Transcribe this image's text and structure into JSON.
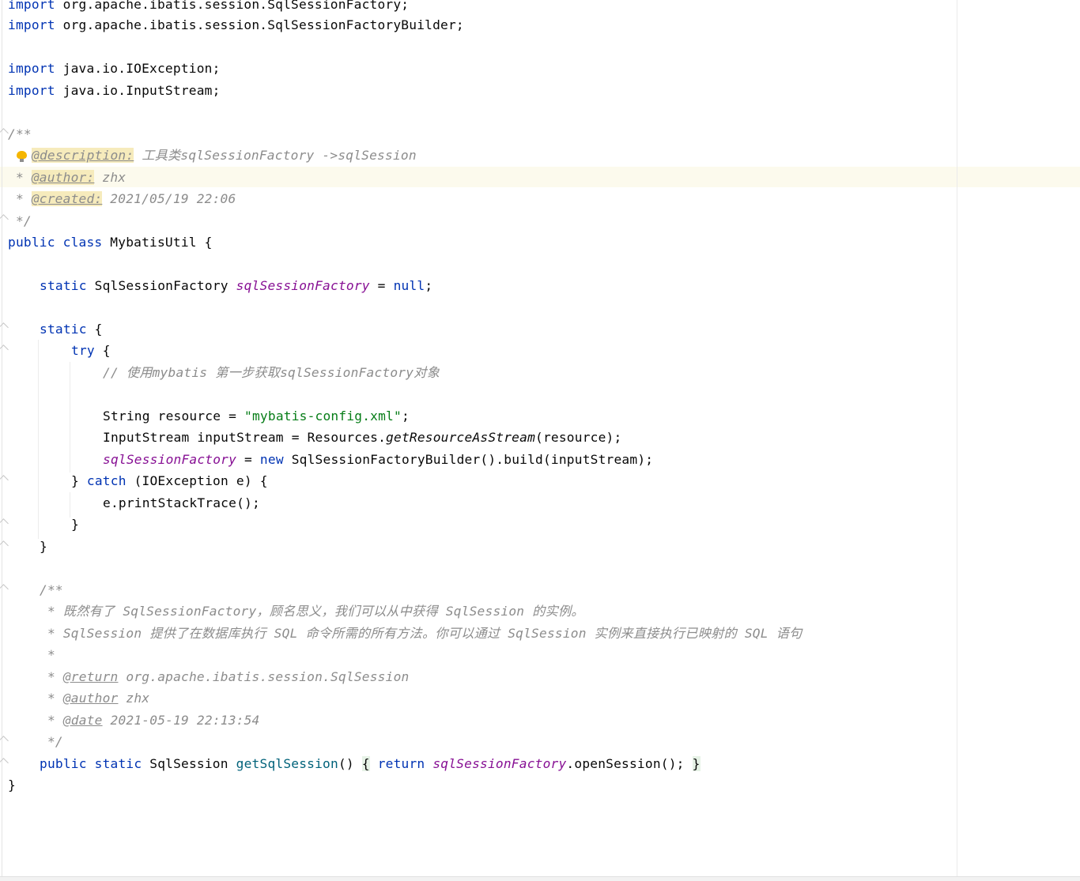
{
  "editor": {
    "language": "java",
    "lines": {
      "l1_kw": "import",
      "l1_rest": " org.apache.ibatis.session.SqlSessionFactory;",
      "l2_kw": "import",
      "l2_rest": " org.apache.ibatis.session.SqlSessionFactoryBuilder;",
      "l4_kw": "import",
      "l4_rest": " java.io.IOException;",
      "l5_kw": "import",
      "l5_rest": " java.io.InputStream;",
      "l7": "/**",
      "l8_tag": "@description:",
      "l8_text": " 工具类sqlSessionFactory ->sqlSession",
      "l9_star": " * ",
      "l9_tag": "@author:",
      "l9_text": " zhx",
      "l10_star": " * ",
      "l10_tag": "@created:",
      "l10_text": " 2021/05/19 22:06",
      "l11": " */",
      "l12_kw": "public class",
      "l12_rest": " MybatisUtil {",
      "l14_kw": "static",
      "l14_type": " SqlSessionFactory ",
      "l14_field": "sqlSessionFactory",
      "l14_eq": " = ",
      "l14_null": "null",
      "l14_end": ";",
      "l16_kw": "static",
      "l16_rest": " {",
      "l17_kw": "try",
      "l17_rest": " {",
      "l18": "// 使用mybatis 第一步获取sqlSessionFactory对象",
      "l20_a": "String resource = ",
      "l20_str": "\"mybatis-config.xml\"",
      "l20_b": ";",
      "l21_a": "InputStream inputStream = Resources.",
      "l21_m": "getResourceAsStream",
      "l21_b": "(resource);",
      "l22_field": "sqlSessionFactory",
      "l22_eq": " = ",
      "l22_new": "new",
      "l22_rest": " SqlSessionFactoryBuilder().build(inputStream);",
      "l23_a": "} ",
      "l23_kw": "catch",
      "l23_b": " (IOException e) {",
      "l24": "e.printStackTrace();",
      "l25": "}",
      "l26": "}",
      "l28": "/**",
      "l29": " * 既然有了 SqlSessionFactory，顾名思义，我们可以从中获得 SqlSession 的实例。",
      "l30": " * SqlSession 提供了在数据库执行 SQL 命令所需的所有方法。你可以通过 SqlSession 实例来直接执行已映射的 SQL 语句",
      "l31": " *",
      "l32_star": " * ",
      "l32_tag": "@return",
      "l32_text": " org.apache.ibatis.session.SqlSession",
      "l33_star": " * ",
      "l33_tag": "@author",
      "l33_text": " zhx",
      "l34_star": " * ",
      "l34_tag": "@date",
      "l34_text": " 2021-05-19 22:13:54",
      "l35": " */",
      "l36_kw": "public static",
      "l36_type": " SqlSession ",
      "l36_fn": "getSqlSession",
      "l36_paren": "() ",
      "l36_ob": "{",
      "l36_sp": " ",
      "l36_ret": "return",
      "l36_sp2": " ",
      "l36_field": "sqlSessionFactory",
      "l36_call": ".openSession(); ",
      "l36_cb": "}",
      "l37": "}"
    }
  }
}
